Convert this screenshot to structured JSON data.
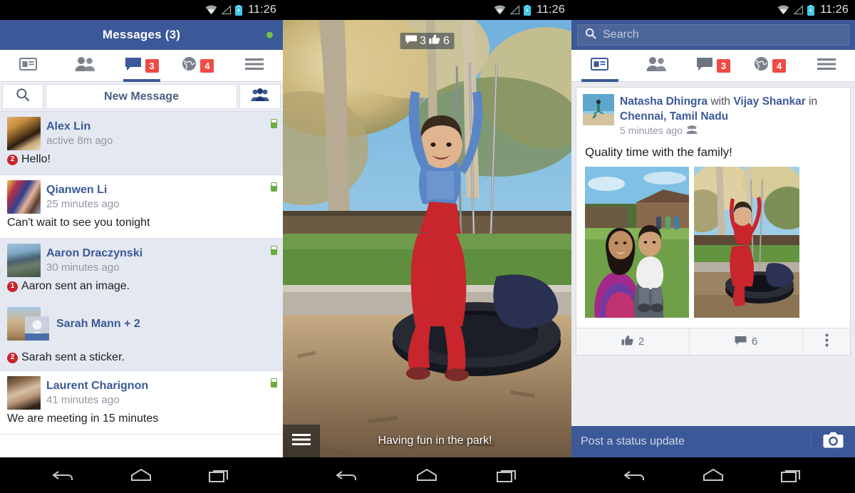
{
  "status_bar": {
    "time": "11:26",
    "icons": [
      "wifi-icon",
      "signal-icon",
      "battery-icon"
    ]
  },
  "colors": {
    "fb_blue": "#3b5998",
    "badge_red": "#f04a46",
    "unread_row": "#e4e8f1",
    "online_green": "#76c043",
    "unread_dot_red": "#c9252c"
  },
  "tabs": [
    {
      "name": "news-feed",
      "icon": "newsfeed-icon",
      "badge": "",
      "active_p1": false,
      "active_p3": true
    },
    {
      "name": "friends",
      "icon": "friends-icon",
      "badge": "",
      "active_p1": false,
      "active_p3": false
    },
    {
      "name": "messages",
      "icon": "message-bubble-icon",
      "badge": "3",
      "active_p1": true,
      "active_p3": false
    },
    {
      "name": "notifications",
      "icon": "globe-icon",
      "badge": "4",
      "active_p1": false,
      "active_p3": false
    },
    {
      "name": "more",
      "icon": "hamburger-icon",
      "badge": "",
      "active_p1": false,
      "active_p3": false
    }
  ],
  "panel_messages": {
    "header_title": "Messages (3)",
    "online_indicator": "online-dot",
    "toolbar": {
      "search_icon": "search-icon",
      "new_message_label": "New Message",
      "group_icon": "group-people-icon"
    },
    "threads": [
      {
        "name": "Alex Lin",
        "time": "active 8m ago",
        "snippet": "Hello!",
        "unread": true,
        "unread_count": "2",
        "has_unread_dot": true,
        "mobile_indicator": true
      },
      {
        "name": "Qianwen  Li",
        "time": "25 minutes ago",
        "snippet": "Can't wait to see you tonight",
        "unread": false,
        "unread_count": "",
        "has_unread_dot": false,
        "mobile_indicator": true
      },
      {
        "name": "Aaron Draczynski",
        "time": "30 minutes ago",
        "snippet": "Aaron sent an image.",
        "unread": true,
        "unread_count": "1",
        "has_unread_dot": true,
        "mobile_indicator": true
      },
      {
        "name": "Sarah Mann + 2",
        "time": "",
        "snippet": "Sarah sent a sticker.",
        "unread": true,
        "unread_count": "2",
        "has_unread_dot": true,
        "mobile_indicator": false
      },
      {
        "name": "Laurent Charignon",
        "time": "41 minutes ago",
        "snippet": "We are meeting in 15 minutes",
        "unread": false,
        "unread_count": "",
        "has_unread_dot": false,
        "mobile_indicator": true
      }
    ]
  },
  "panel_photo": {
    "comment_icon": "comment-bubble-icon",
    "comment_count": "3",
    "like_icon": "thumbs-up-icon",
    "like_count": "6",
    "menu_icon": "hamburger-icon",
    "caption": "Having fun in the park!"
  },
  "panel_feed": {
    "search_placeholder": "Search",
    "search_icon": "search-icon",
    "post": {
      "author": "Natasha Dhingra",
      "with_word": "with",
      "tagged": "Vijay Shankar",
      "in_word": "in",
      "location": "Chennai, Tamil Nadu",
      "timestamp": "5 minutes ago",
      "audience_icon": "friends-audience-icon",
      "message": "Quality time with the family!",
      "photos": [
        "photo-mother-and-child",
        "photo-child-on-tire-swing"
      ],
      "actions": [
        {
          "icon": "thumbs-up-icon",
          "label": "2",
          "name": "like-button"
        },
        {
          "icon": "comment-bubble-icon",
          "label": "6",
          "name": "comment-button"
        },
        {
          "icon": "overflow-dots-icon",
          "label": "",
          "name": "more-options-button"
        }
      ]
    },
    "composer_placeholder": "Post a status update",
    "composer_camera_icon": "camera-icon"
  },
  "nav_bar": {
    "back": "back-icon",
    "home": "home-icon",
    "recents": "recents-icon"
  }
}
